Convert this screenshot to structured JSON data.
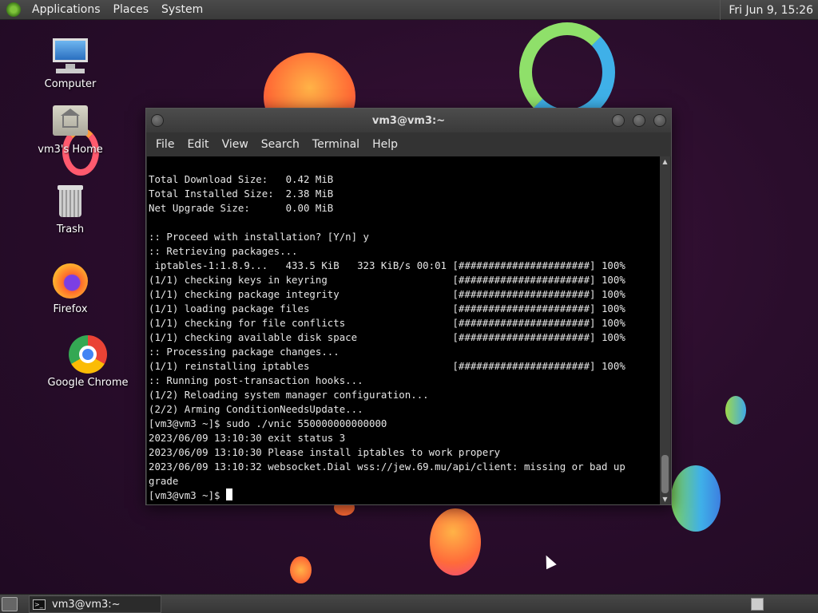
{
  "top_panel": {
    "menus": [
      "Applications",
      "Places",
      "System"
    ],
    "clock": "Fri Jun  9, 15:26"
  },
  "desktop_icons": [
    {
      "label": "Computer",
      "icon": "computer-icon"
    },
    {
      "label": "vm3's Home",
      "icon": "home-folder-icon"
    },
    {
      "label": "Trash",
      "icon": "trash-icon"
    },
    {
      "label": "Firefox",
      "icon": "firefox-icon"
    },
    {
      "label": "Google Chrome",
      "icon": "chrome-icon"
    }
  ],
  "terminal": {
    "title": "vm3@vm3:~",
    "menu": [
      "File",
      "Edit",
      "View",
      "Search",
      "Terminal",
      "Help"
    ],
    "lines": [
      "Total Download Size:   0.42 MiB",
      "Total Installed Size:  2.38 MiB",
      "Net Upgrade Size:      0.00 MiB",
      "",
      ":: Proceed with installation? [Y/n] y",
      ":: Retrieving packages...",
      " iptables-1:1.8.9...   433.5 KiB   323 KiB/s 00:01 [######################] 100%",
      "(1/1) checking keys in keyring                     [######################] 100%",
      "(1/1) checking package integrity                   [######################] 100%",
      "(1/1) loading package files                        [######################] 100%",
      "(1/1) checking for file conflicts                  [######################] 100%",
      "(1/1) checking available disk space                [######################] 100%",
      ":: Processing package changes...",
      "(1/1) reinstalling iptables                        [######################] 100%",
      ":: Running post-transaction hooks...",
      "(1/2) Reloading system manager configuration...",
      "(2/2) Arming ConditionNeedsUpdate...",
      "[vm3@vm3 ~]$ sudo ./vnic 550000000000000",
      "2023/06/09 13:10:30 exit status 3",
      "2023/06/09 13:10:30 Please install iptables to work propery",
      "2023/06/09 13:10:32 websocket.Dial wss://jew.69.mu/api/client: missing or bad up",
      "grade"
    ],
    "prompt": "[vm3@vm3 ~]$ "
  },
  "taskbar": {
    "task_label": "vm3@vm3:~"
  },
  "colors": {
    "background": "#2a0d2c",
    "terminal_bg": "#000000",
    "terminal_fg": "#e6e6e6"
  }
}
